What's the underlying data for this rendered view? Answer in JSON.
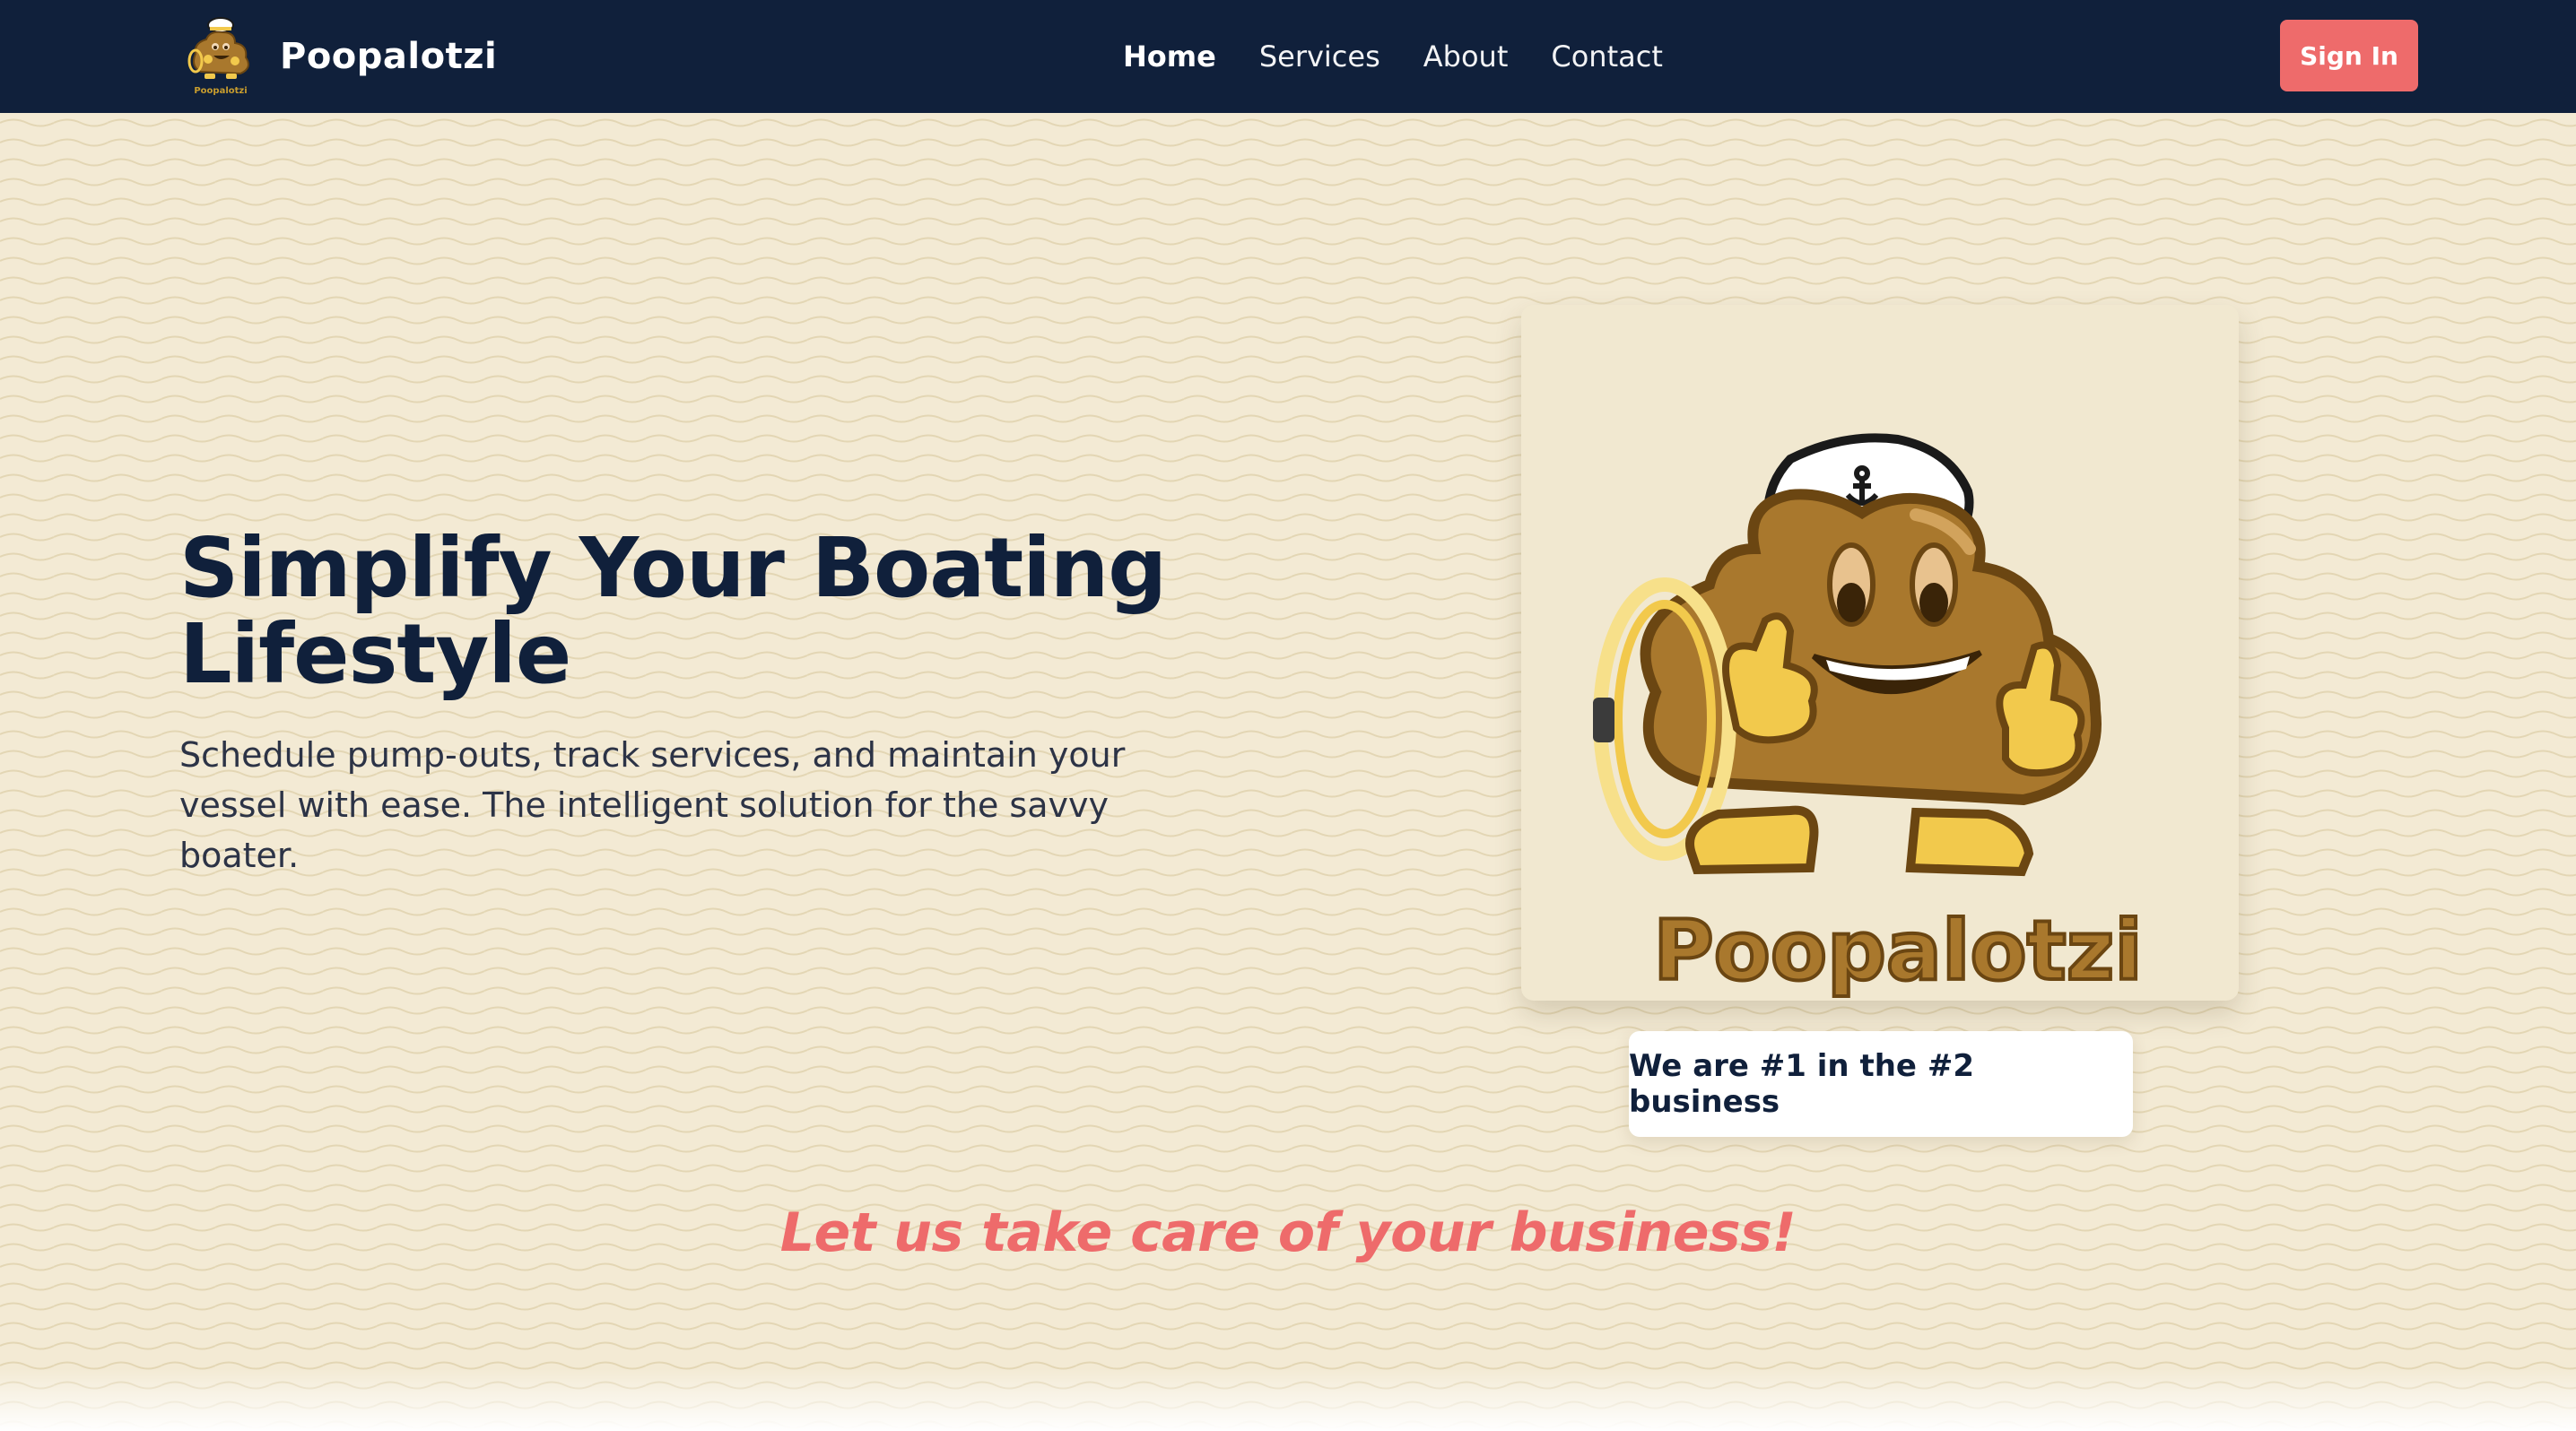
{
  "navbar": {
    "brand_name": "Poopalotzi",
    "logo_text": "Poopalotzi",
    "links": [
      {
        "label": "Home",
        "active": true
      },
      {
        "label": "Services",
        "active": false
      },
      {
        "label": "About",
        "active": false
      },
      {
        "label": "Contact",
        "active": false
      }
    ],
    "signin_label": "Sign In"
  },
  "hero": {
    "title": "Simplify Your Boating Lifestyle",
    "subtitle": "Schedule pump-outs, track services, and maintain your vessel with ease. The intelligent solution for the savvy boater.",
    "mascot_wordmark": "Poopalotzi",
    "tagline": "We are #1 in the #2 business"
  },
  "cta": {
    "text": "Let us take care of your business!"
  },
  "colors": {
    "navbar": "#10203b",
    "accent": "#ee6b6b",
    "background": "#f3ead4",
    "heading": "#10203b",
    "mascot_brown": "#a9782d",
    "mascot_gold": "#f2c94c"
  },
  "icons": {
    "brand_logo": "poop-captain-mascot-icon",
    "hero_mascot": "poop-captain-mascot-illustration"
  }
}
